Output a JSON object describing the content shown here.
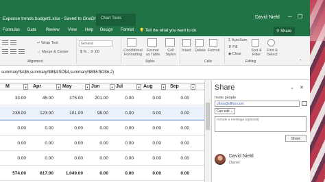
{
  "window": {
    "title": "Expense trends budget1.xlsx  -  Saved to OneDrive",
    "contextual_tab_group": "Chart Tools",
    "user": "David Nield"
  },
  "tabs": [
    "Formulas",
    "Data",
    "Review",
    "View",
    "Help",
    "Design",
    "Format"
  ],
  "tell_me": "Tell me what you want to do",
  "share_button": "Share",
  "ribbon": {
    "wrap_text": "Wrap Text",
    "merge_center": "Merge & Center",
    "number_format": "General",
    "conditional_formatting": "Conditional Formatting",
    "format_as_table": "Format as Table",
    "cell_styles": "Cell Styles",
    "insert": "Insert",
    "delete": "Delete",
    "format": "Format",
    "autosum": "AutoSum",
    "fill": "Fill",
    "clear": "Clear",
    "sort_filter": "Sort & Filter",
    "find_select": "Find & Select",
    "groups": {
      "alignment": "Alignment",
      "styles": "Styles",
      "cells": "Cells",
      "editing": "Editing"
    }
  },
  "formula": "summary!$A$6,summary!$B$4:$O$4,summary!$B$6:$O$6,2)",
  "grid": {
    "columns": [
      "M",
      "Apr",
      "May",
      "Jun",
      "Jul",
      "Aug",
      "Sep"
    ],
    "rows": [
      {
        "cells": [
          "33.00",
          "45.00",
          "375.00",
          "201.00",
          "0.00",
          "0.00",
          "0.00"
        ],
        "selected": false
      },
      {
        "cells": [
          "238.00",
          "123.00",
          "101.00",
          "98.00",
          "0.00",
          "0.00",
          "0.00"
        ],
        "selected": true
      },
      {
        "cells": [
          "0.00",
          "0.00",
          "0.00",
          "0.00",
          "0.00",
          "0.00",
          "0.00"
        ],
        "selected": false
      },
      {
        "cells": [
          "0.00",
          "0.00",
          "0.00",
          "0.00",
          "0.00",
          "0.00",
          "0.00"
        ],
        "selected": false
      },
      {
        "cells": [
          "0.00",
          "0.00",
          "0.00",
          "0.00",
          "0.00",
          "0.00",
          "0.00"
        ],
        "selected": false
      },
      {
        "cells": [
          "574.00",
          "817.00",
          "1,049.00",
          "0.00",
          "0.00",
          "0.00",
          "0.00"
        ],
        "selected": false,
        "total": true
      }
    ]
  },
  "share_pane": {
    "title": "Share",
    "invite_label": "Invite people",
    "invite_value": "cthris@office.com",
    "permission": "Can edit",
    "message_placeholder": "Include a message (optional)",
    "share_action": "Share",
    "owner_name": "David Nield",
    "owner_role": "Owner"
  },
  "colors": {
    "excel_green": "#217346",
    "selection_blue": "#4472c4"
  }
}
